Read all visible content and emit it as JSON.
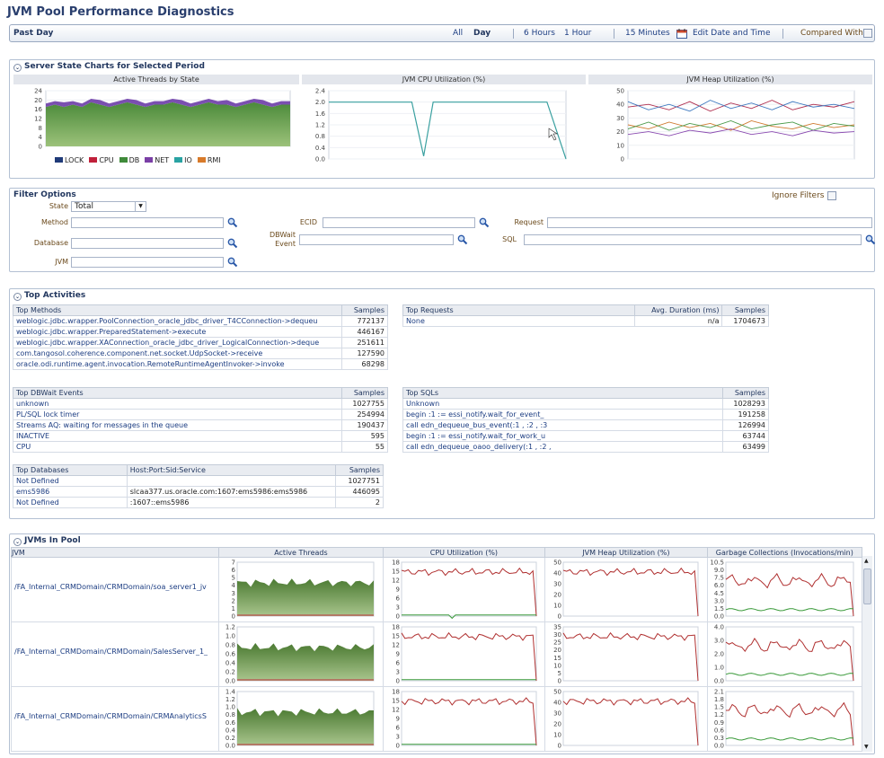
{
  "page": {
    "title": "JVM Pool Performance Diagnostics"
  },
  "period_bar": {
    "label": "Past Day",
    "all": "All",
    "day": "Day",
    "six_hours": "6 Hours",
    "one_hour": "1 Hour",
    "fifteen_min": "15 Minutes",
    "edit": "Edit Date and Time",
    "compared": "Compared With",
    "compared_checked": false
  },
  "server_state": {
    "title": "Server State Charts for Selected Period",
    "charts": [
      {
        "title": "Active Threads by State",
        "type": "area",
        "ylim": [
          0,
          24
        ],
        "yticks": [
          "24",
          "20",
          "16",
          "12",
          "8",
          "4",
          "0"
        ],
        "legend": [
          {
            "name": "LOCK",
            "color": "#1f3a78"
          },
          {
            "name": "CPU",
            "color": "#c0203a"
          },
          {
            "name": "DB",
            "color": "#3f8a3a"
          },
          {
            "name": "NET",
            "color": "#7a3fa6"
          },
          {
            "name": "IO",
            "color": "#2aa3a3"
          },
          {
            "name": "RMI",
            "color": "#d87a2a"
          }
        ]
      },
      {
        "title": "JVM CPU Utilization (%)",
        "type": "line",
        "ylim": [
          0,
          2.4
        ],
        "yticks": [
          "2.4",
          "2.0",
          "1.6",
          "1.2",
          "0.8",
          "0.4",
          "0.0"
        ]
      },
      {
        "title": "JVM Heap Utilization (%)",
        "type": "line",
        "ylim": [
          0,
          50
        ],
        "yticks": [
          "50",
          "40",
          "30",
          "20",
          "10",
          "0"
        ]
      }
    ]
  },
  "chart_data": [
    {
      "type": "area",
      "title": "Active Threads by State",
      "ylim": [
        0,
        24
      ],
      "series": [
        {
          "name": "DB",
          "values": [
            17,
            18,
            17,
            18,
            17,
            19,
            18,
            17,
            18,
            19,
            18,
            17,
            18,
            18,
            19,
            18,
            17,
            18,
            19,
            18,
            18,
            17,
            18,
            19,
            18,
            17,
            18,
            18
          ]
        },
        {
          "name": "NET",
          "values": [
            1.5,
            1.5,
            2,
            1.5,
            1.5,
            1.5,
            2,
            1.5,
            1.5,
            1.5,
            2,
            1.5,
            1.5,
            1.5,
            1.5,
            2,
            1.5,
            1.5,
            1.5,
            1.5,
            2,
            1.5,
            1.5,
            1.5,
            2,
            1.5,
            1.5,
            1.5
          ]
        }
      ]
    },
    {
      "type": "line",
      "title": "JVM CPU Utilization (%)",
      "ylim": [
        0,
        2.4
      ],
      "series": [
        {
          "name": "CPU",
          "x": [
            0,
            0.35,
            0.4,
            0.44,
            0.88,
            0.92,
            1
          ],
          "values": [
            2.0,
            2.0,
            0.1,
            2.0,
            2.0,
            2.0,
            0.0
          ]
        }
      ]
    },
    {
      "type": "line",
      "title": "JVM Heap Utilization (%)",
      "ylim": [
        0,
        50
      ],
      "series": [
        {
          "values": [
            38,
            40,
            36,
            42,
            35,
            41,
            37,
            43,
            36,
            40,
            38,
            42
          ]
        },
        {
          "values": [
            42,
            36,
            40,
            35,
            43,
            37,
            41,
            36,
            42,
            38,
            40,
            37
          ]
        },
        {
          "values": [
            25,
            22,
            27,
            23,
            26,
            21,
            28,
            24,
            22,
            26,
            23,
            25
          ]
        },
        {
          "values": [
            22,
            27,
            21,
            26,
            23,
            28,
            22,
            25,
            27,
            21,
            26,
            24
          ]
        },
        {
          "values": [
            18,
            20,
            17,
            21,
            19,
            22,
            18,
            20,
            17,
            21,
            19,
            20
          ]
        }
      ]
    }
  ],
  "filters": {
    "title": "Filter Options",
    "ignore": "Ignore Filters",
    "state_label": "State",
    "state_value": "Total",
    "method": "Method",
    "ecid": "ECID",
    "request": "Request",
    "database": "Database",
    "dbwait": "DBWait Event",
    "sql": "SQL",
    "jvm": "JVM"
  },
  "top": {
    "title": "Top Activities",
    "methods": {
      "h1": "Top Methods",
      "h2": "Samples",
      "rows": [
        [
          "weblogic.jdbc.wrapper.PoolConnection_oracle_jdbc_driver_T4CConnection->dequeu",
          "772137"
        ],
        [
          "weblogic.jdbc.wrapper.PreparedStatement->execute",
          "446167"
        ],
        [
          "weblogic.jdbc.wrapper.XAConnection_oracle_jdbc_driver_LogicalConnection->deque",
          "251611"
        ],
        [
          "com.tangosol.coherence.component.net.socket.UdpSocket->receive",
          "127590"
        ],
        [
          "oracle.odi.runtime.agent.invocation.RemoteRuntimeAgentInvoker->invoke",
          "68298"
        ]
      ]
    },
    "requests": {
      "h1": "Top Requests",
      "h2": "Avg. Duration (ms)",
      "h3": "Samples",
      "rows": [
        [
          "None",
          "n/a",
          "1704673"
        ]
      ]
    },
    "dbwait": {
      "h1": "Top DBWait Events",
      "h2": "Samples",
      "rows": [
        [
          "unknown",
          "1027755"
        ],
        [
          "PL/SQL lock timer",
          "254994"
        ],
        [
          "Streams AQ: waiting for messages in the queue",
          "190437"
        ],
        [
          "INACTIVE",
          "595"
        ],
        [
          "CPU",
          "55"
        ]
      ]
    },
    "sqls": {
      "h1": "Top SQLs",
      "h2": "Samples",
      "rows": [
        [
          "Unknown",
          "1028293"
        ],
        [
          "begin :1 := essi_notify.wait_for_event_",
          "191258"
        ],
        [
          "call edn_dequeue_bus_event(:1 , :2 , :3",
          "126994"
        ],
        [
          "begin :1 := essi_notify.wait_for_work_u",
          "63744"
        ],
        [
          "call edn_dequeue_oaoo_delivery(:1 , :2 ,",
          "63499"
        ]
      ]
    },
    "dbs": {
      "h1": "Top Databases",
      "h2": "Host:Port:Sid:Service",
      "h3": "Samples",
      "rows": [
        [
          "Not Defined",
          "",
          "1027751"
        ],
        [
          "ems5986",
          "slcaa377.us.oracle.com:1607:ems5986:ems5986",
          "446095"
        ],
        [
          "Not Defined",
          ":1607::ems5986",
          "2"
        ]
      ]
    }
  },
  "jvms": {
    "title": "JVMs In Pool",
    "cols": [
      "JVM",
      "Active Threads",
      "CPU Utilization (%)",
      "JVM Heap Utilization (%)",
      "Garbage Collections (Invocations/min)"
    ],
    "rows": [
      {
        "name": "/FA_Internal_CRMDomain/CRMDomain/soa_server1_jv",
        "t": [
          "7",
          "6",
          "5",
          "4",
          "3",
          "2",
          "1",
          "0"
        ],
        "c": [
          "18",
          "15",
          "12",
          "9",
          "6",
          "3",
          "0"
        ],
        "h": [
          "50",
          "40",
          "30",
          "20",
          "10",
          "0"
        ],
        "g": [
          "10.5",
          "9.0",
          "7.5",
          "6.0",
          "4.5",
          "3.0",
          "1.5",
          "0.0"
        ]
      },
      {
        "name": "/FA_Internal_CRMDomain/CRMDomain/SalesServer_1_",
        "t": [
          "1.2",
          "1.0",
          "0.8",
          "0.6",
          "0.4",
          "0.2",
          "0.0"
        ],
        "c": [
          "18",
          "15",
          "12",
          "9",
          "6",
          "3",
          "0"
        ],
        "h": [
          "35",
          "30",
          "25",
          "20",
          "15",
          "10",
          "5",
          "0"
        ],
        "g": [
          "4.0",
          "3.0",
          "2.0",
          "1.0",
          "0.0"
        ]
      },
      {
        "name": "/FA_Internal_CRMDomain/CRMDomain/CRMAnalyticsS",
        "t": [
          "1.4",
          "1.2",
          "1.0",
          "0.8",
          "0.6",
          "0.4",
          "0.2",
          "0.0"
        ],
        "c": [
          "18",
          "15",
          "12",
          "9",
          "6",
          "3",
          "0"
        ],
        "h": [
          "50",
          "40",
          "30",
          "20",
          "10",
          "0"
        ],
        "g": [
          "2.1",
          "1.8",
          "1.5",
          "1.2",
          "0.9",
          "0.6",
          "0.3",
          "0.0"
        ]
      }
    ]
  }
}
